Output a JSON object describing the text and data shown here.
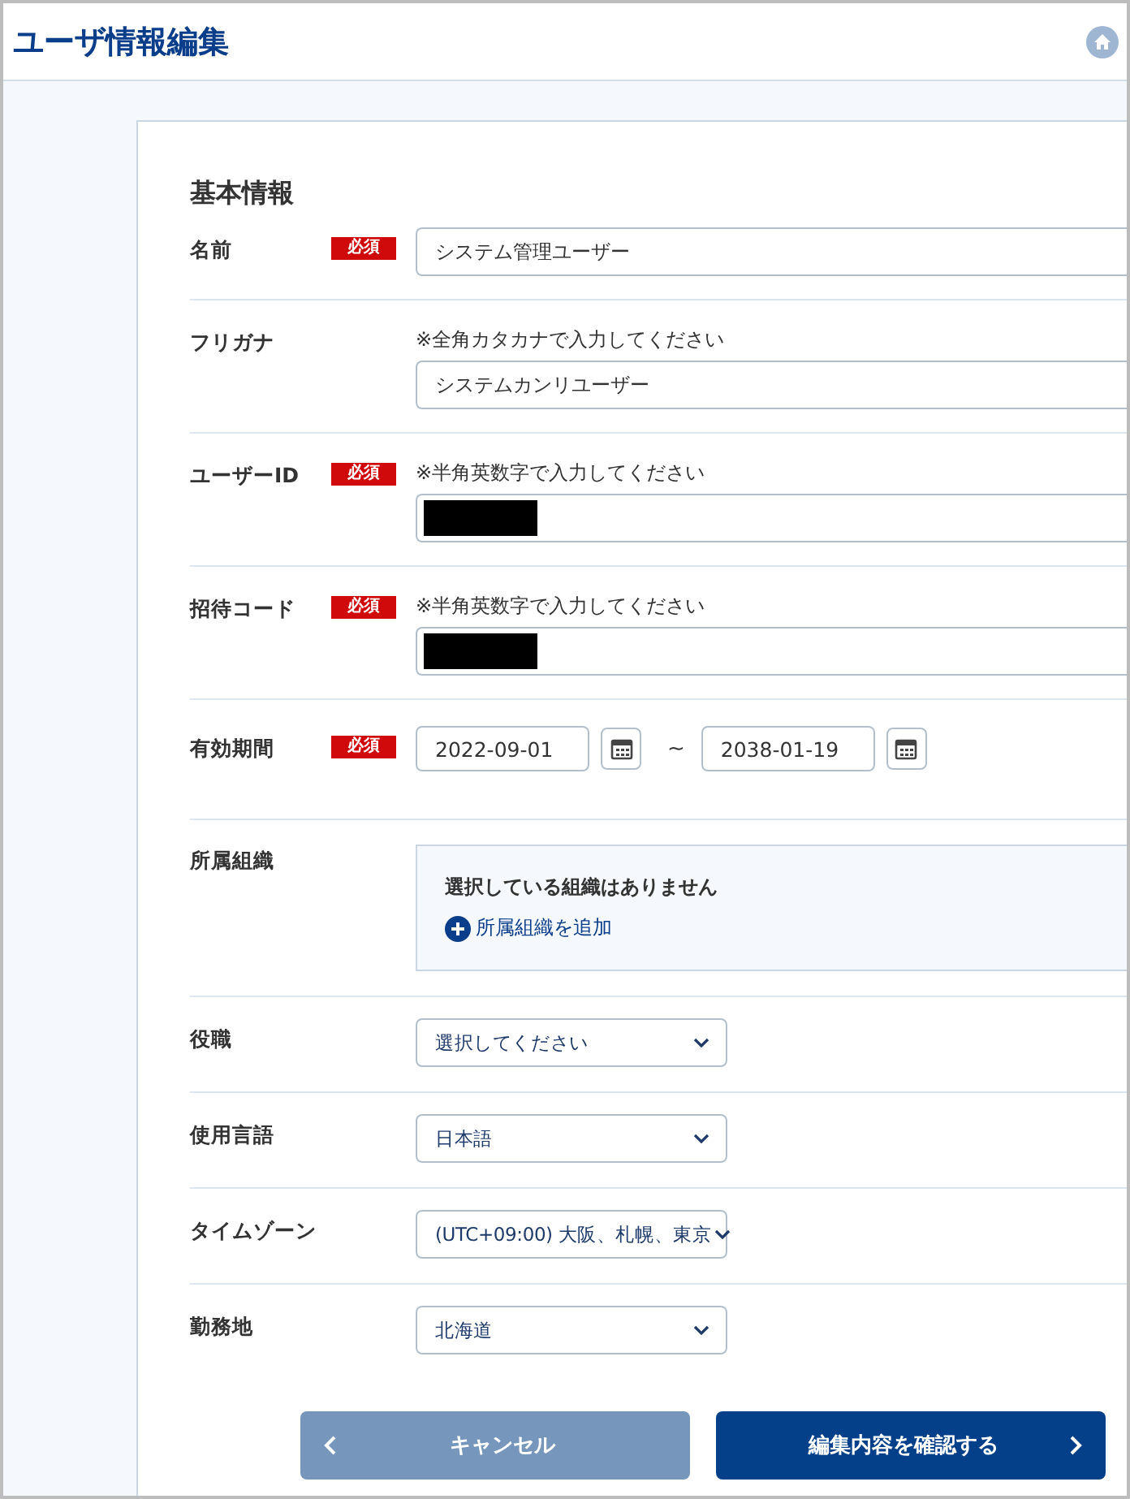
{
  "page": {
    "title": "ユーザ情報編集"
  },
  "section": {
    "title": "基本情報"
  },
  "fields": [
    {
      "kind": "text",
      "label": "名前",
      "badge": "必須",
      "value": "システム管理ユーザー"
    },
    {
      "kind": "text",
      "label": "フリガナ",
      "hint": "※全角カタカナで入力してください",
      "value": "システムカンリユーザー"
    },
    {
      "kind": "text",
      "label": "ユーザーID",
      "badge": "必須",
      "hint": "※半角英数字で入力してください",
      "redacted": true
    },
    {
      "kind": "text",
      "label": "招待コード",
      "badge": "必須",
      "hint": "※半角英数字で入力してください",
      "redacted": true
    },
    {
      "kind": "date_range",
      "label": "有効期間",
      "badge": "必須",
      "start": "2022-09-01",
      "separator": "~",
      "end": "2038-01-19"
    },
    {
      "kind": "org",
      "label": "所属組織",
      "empty_text": "選択している組織はありません",
      "add_link": "所属組織を追加"
    },
    {
      "kind": "select",
      "label": "役職",
      "value": "選択してください"
    },
    {
      "kind": "select",
      "label": "使用言語",
      "value": "日本語"
    },
    {
      "kind": "select",
      "label": "タイムゾーン",
      "value": "(UTC+09:00) 大阪、札幌、東京"
    },
    {
      "kind": "select",
      "label": "勤務地",
      "value": "北海道"
    }
  ],
  "buttons": [
    {
      "kind": "back",
      "label": "キャンセル"
    },
    {
      "kind": "next",
      "label": "編集内容を確認する"
    }
  ]
}
